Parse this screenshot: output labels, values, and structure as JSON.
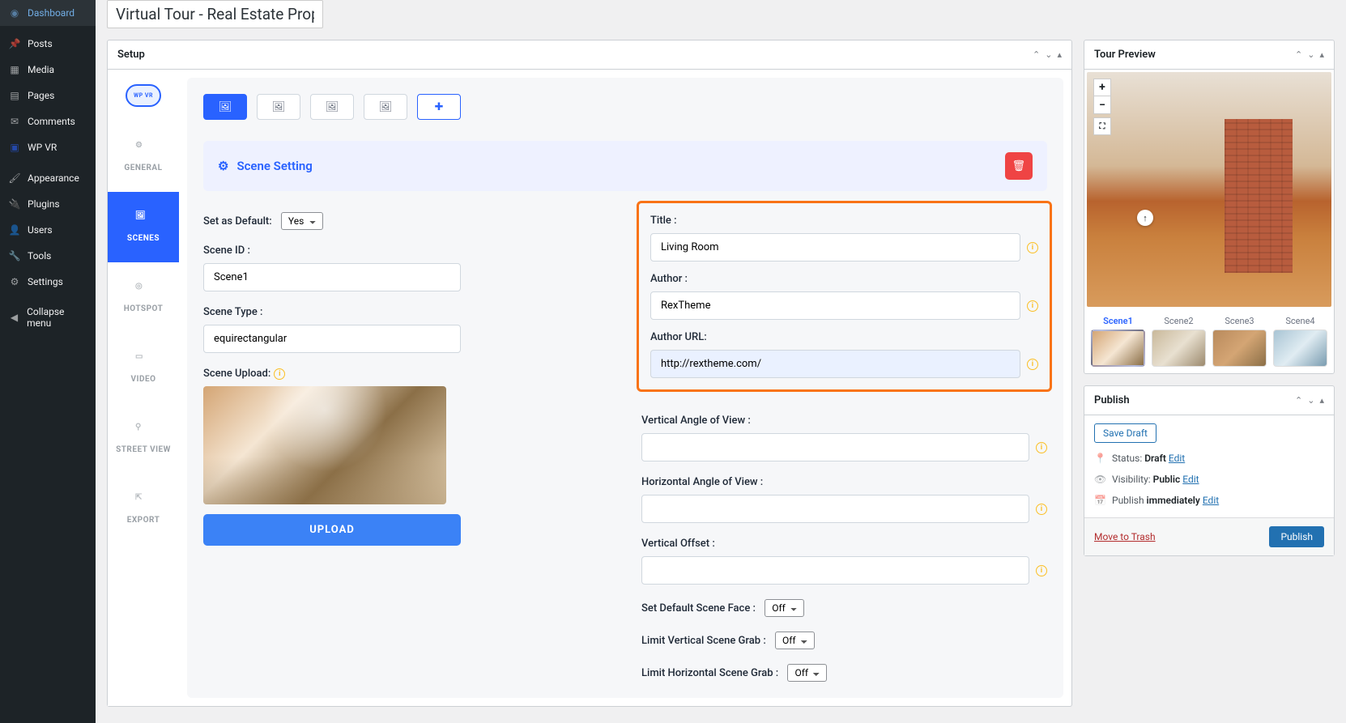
{
  "sidebar": {
    "items": [
      {
        "label": "Dashboard",
        "icon": "◉"
      },
      {
        "label": "Posts",
        "icon": "✎"
      },
      {
        "label": "Media",
        "icon": "▦"
      },
      {
        "label": "Pages",
        "icon": "▤"
      },
      {
        "label": "Comments",
        "icon": "✉"
      },
      {
        "label": "WP VR",
        "icon": "▣"
      },
      {
        "label": "Appearance",
        "icon": "✦"
      },
      {
        "label": "Plugins",
        "icon": "⚙"
      },
      {
        "label": "Users",
        "icon": "▲"
      },
      {
        "label": "Tools",
        "icon": "✦"
      },
      {
        "label": "Settings",
        "icon": "⚙"
      },
      {
        "label": "Collapse menu",
        "icon": "◀"
      }
    ]
  },
  "page_title": "Virtual Tour - Real Estate Property",
  "setup": {
    "title": "Setup",
    "tabs": {
      "general": "GENERAL",
      "scenes": "SCENES",
      "hotspot": "HOTSPOT",
      "video": "VIDEO",
      "street_view": "STREET VIEW",
      "export": "EXPORT"
    },
    "scene_setting_label": "Scene Setting",
    "fields": {
      "set_default_label": "Set as Default:",
      "set_default_value": "Yes",
      "scene_id_label": "Scene ID :",
      "scene_id_value": "Scene1",
      "scene_type_label": "Scene Type :",
      "scene_type_value": "equirectangular",
      "scene_upload_label": "Scene Upload:",
      "upload_btn": "UPLOAD",
      "title_label": "Title :",
      "title_value": "Living Room",
      "author_label": "Author :",
      "author_value": "RexTheme",
      "author_url_label": "Author URL:",
      "author_url_value": "http://rextheme.com/",
      "vertical_angle_label": "Vertical Angle of View :",
      "horizontal_angle_label": "Horizontal Angle of View :",
      "vertical_offset_label": "Vertical Offset :",
      "default_face_label": "Set Default Scene Face :",
      "default_face_value": "Off",
      "limit_vertical_label": "Limit Vertical Scene Grab :",
      "limit_vertical_value": "Off",
      "limit_horizontal_label": "Limit Horizontal Scene Grab :",
      "limit_horizontal_value": "Off"
    },
    "logo_text": "WP VR"
  },
  "tour_preview": {
    "title": "Tour Preview",
    "scenes": [
      "Scene1",
      "Scene2",
      "Scene3",
      "Scene4"
    ]
  },
  "publish": {
    "title": "Publish",
    "save_draft": "Save Draft",
    "status_label": "Status:",
    "status_value": "Draft",
    "visibility_label": "Visibility:",
    "visibility_value": "Public",
    "publish_time_label": "Publish",
    "publish_time_value": "immediately",
    "edit": "Edit",
    "trash": "Move to Trash",
    "publish_btn": "Publish"
  }
}
